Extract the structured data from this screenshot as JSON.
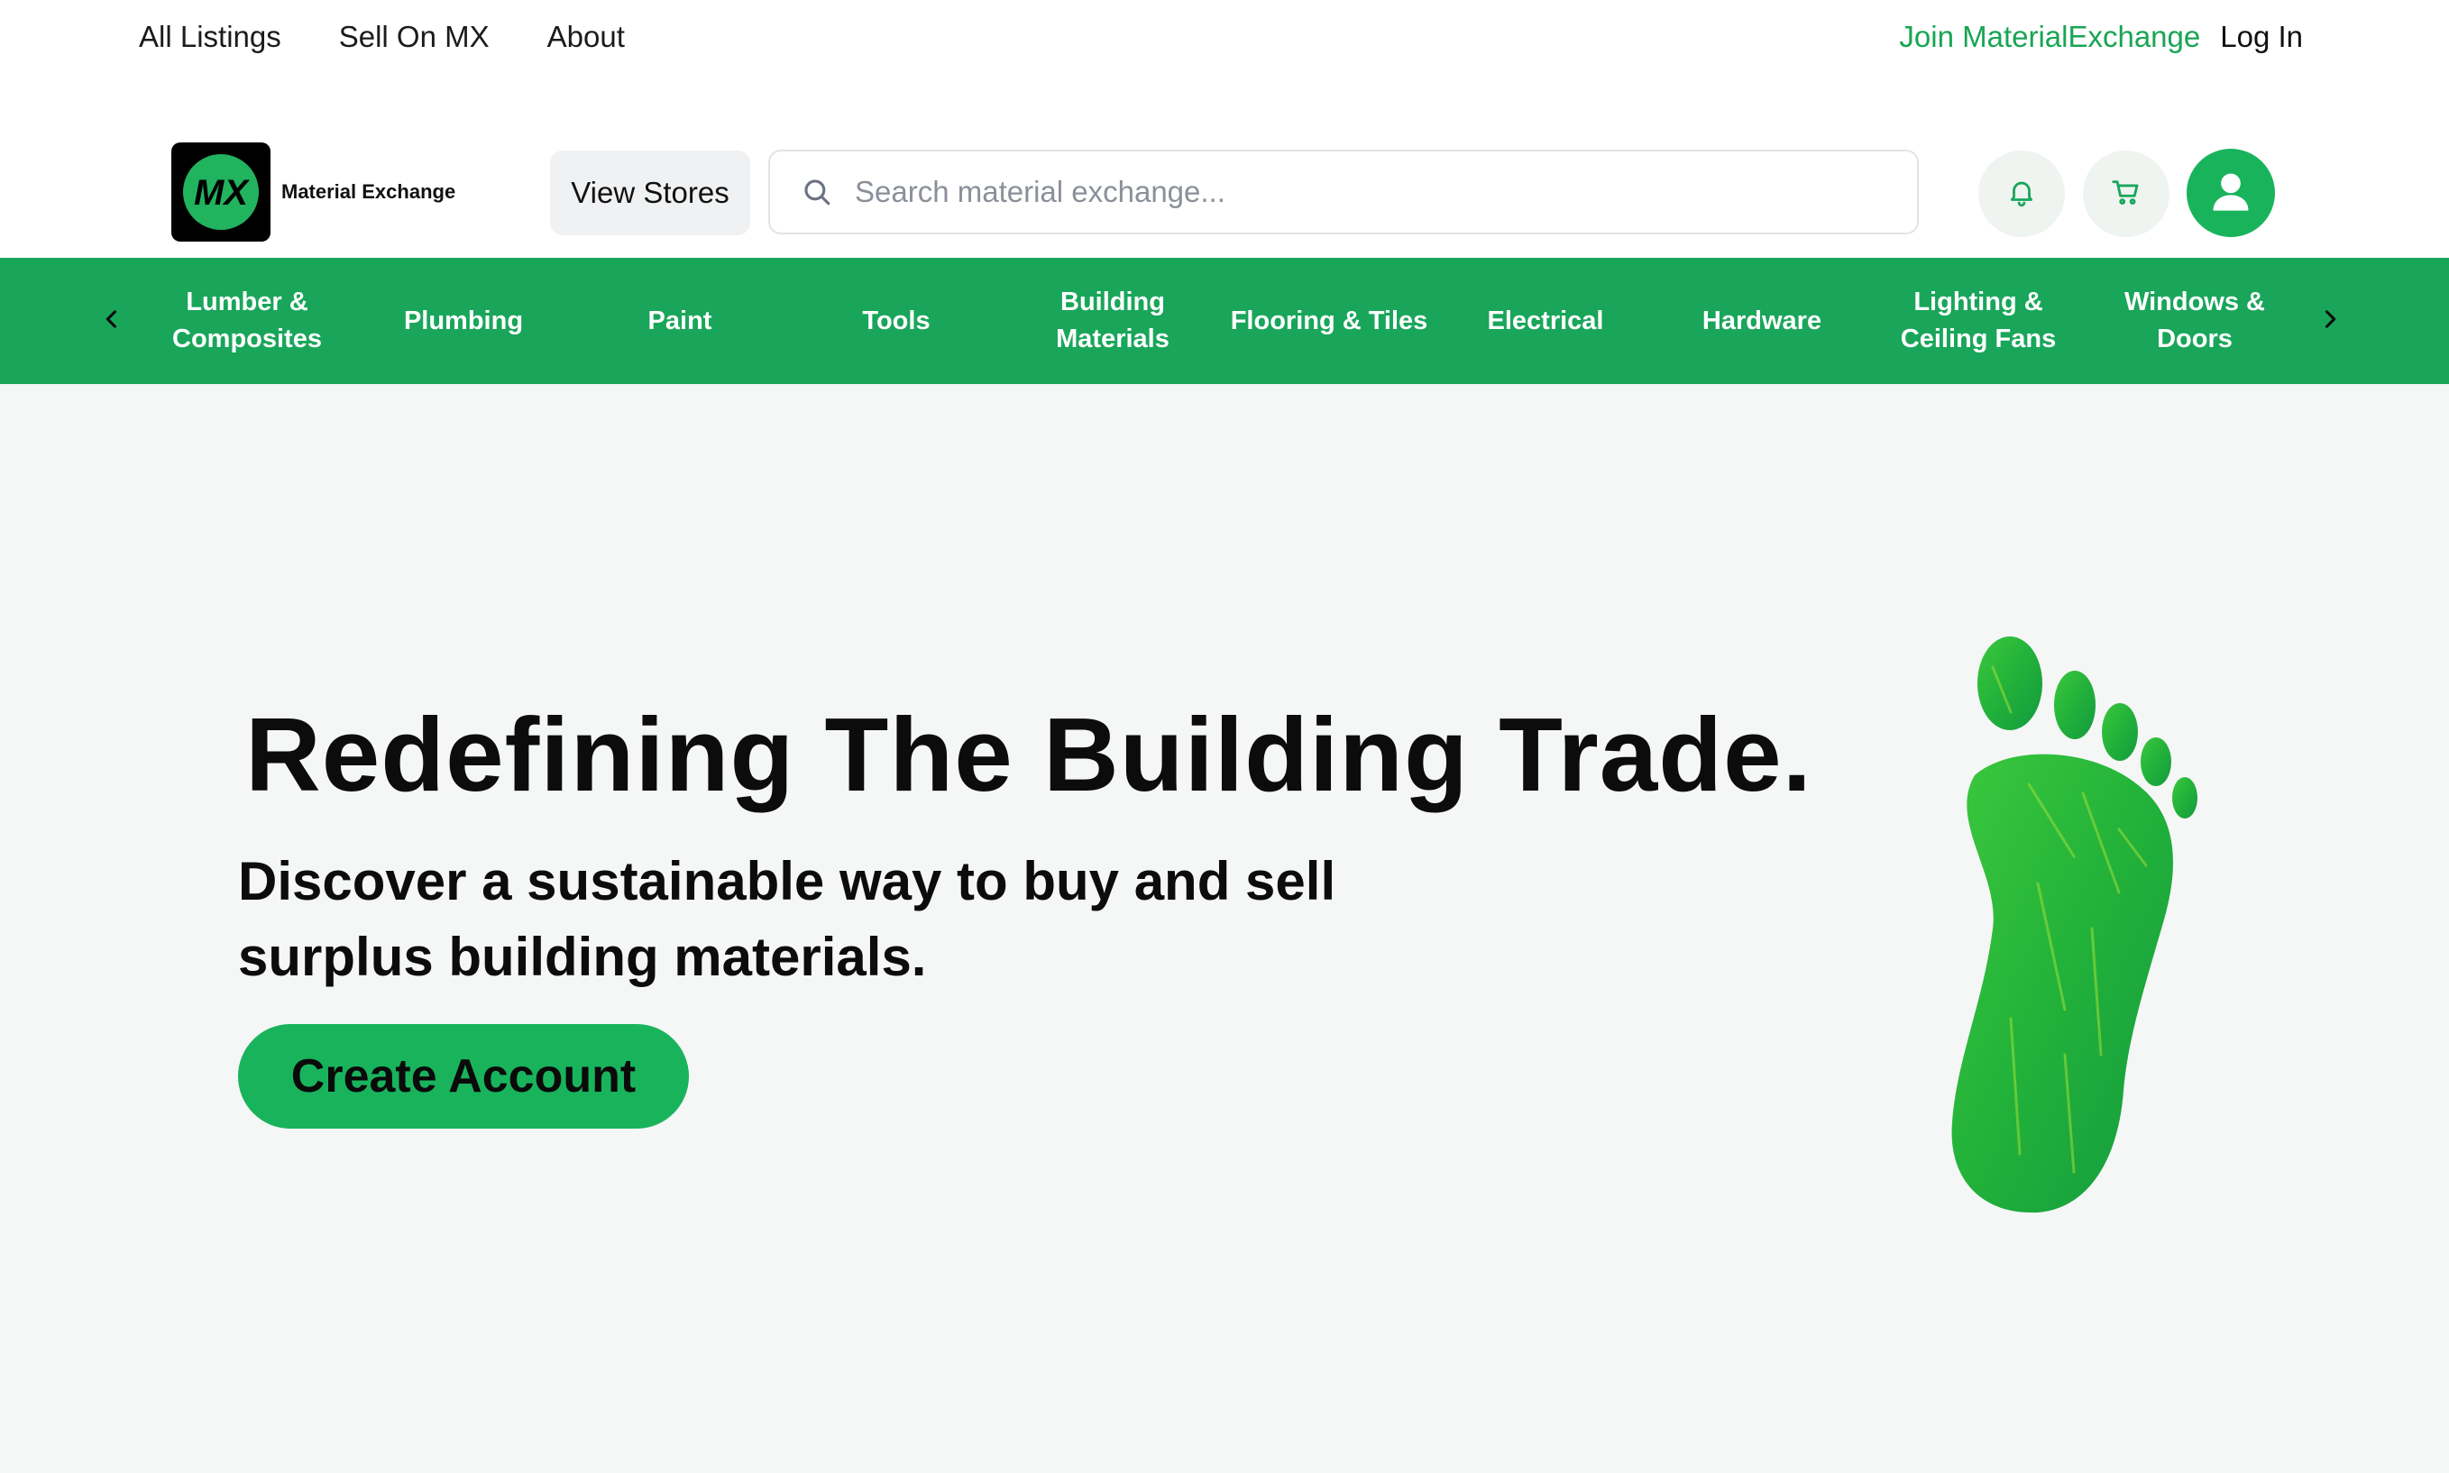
{
  "top_nav": {
    "links": [
      "All Listings",
      "Sell On MX",
      "About"
    ],
    "join_label": "Join MaterialExchange",
    "login_label": "Log In"
  },
  "header": {
    "logo_text": "Material Exchange",
    "logo_mark": "MX",
    "view_stores_label": "View Stores",
    "search_placeholder": "Search material exchange...",
    "icons": [
      "search-icon",
      "bell-icon",
      "cart-icon",
      "user-icon"
    ]
  },
  "categories": [
    "Lumber & Composites",
    "Plumbing",
    "Paint",
    "Tools",
    "Building Materials",
    "Flooring & Tiles",
    "Electrical",
    "Hardware",
    "Lighting & Ceiling Fans",
    "Windows & Doors"
  ],
  "hero": {
    "title": "Redefining The Building Trade.",
    "subtitle": "Discover a sustainable way to buy and sell surplus building materials.",
    "cta_label": "Create Account"
  },
  "colors": {
    "brand_green": "#19a65a",
    "accent_green": "#19b35c",
    "join_link": "#19a554",
    "background": "#f5f6f6"
  }
}
